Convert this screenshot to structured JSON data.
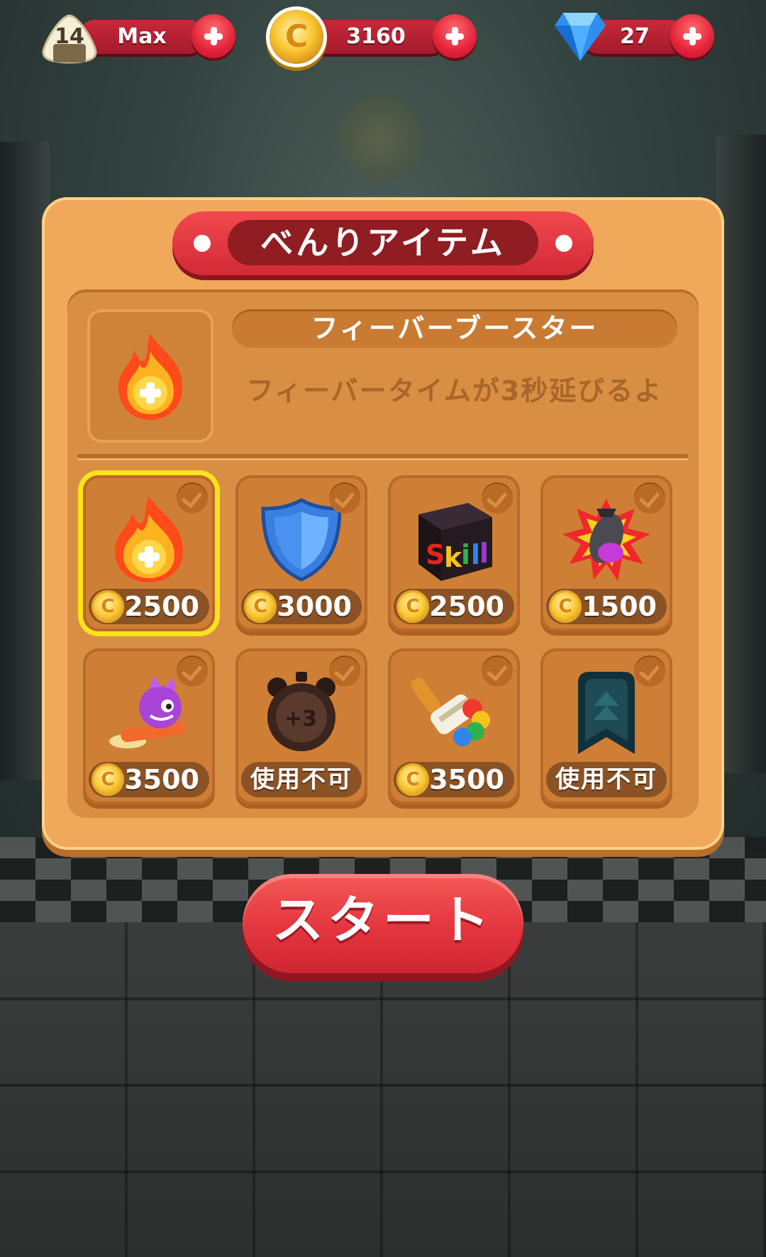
{
  "hud": {
    "level": {
      "number": "14",
      "label": "Max"
    },
    "coins": "3160",
    "gems": "27"
  },
  "panel": {
    "title": "べんりアイテム",
    "selected_item": {
      "name": "フィーバーブースター",
      "description": "フィーバータイムが3秒延びるよ"
    },
    "items": [
      {
        "icon": "fever-booster-icon",
        "price": "2500",
        "selected": true
      },
      {
        "icon": "shield-icon",
        "price": "3000",
        "selected": false
      },
      {
        "icon": "skill-cube-icon",
        "price": "2500",
        "selected": false
      },
      {
        "icon": "bomb-icon",
        "price": "1500",
        "selected": false
      },
      {
        "icon": "dragon-surf-icon",
        "price": "3500",
        "selected": false
      },
      {
        "icon": "timer-plus3-icon",
        "price": "使用不可",
        "selected": false
      },
      {
        "icon": "paint-brush-icon",
        "price": "3500",
        "selected": false
      },
      {
        "icon": "rank-badge-icon",
        "price": "使用不可",
        "selected": false
      }
    ]
  },
  "start_button": "スタート"
}
